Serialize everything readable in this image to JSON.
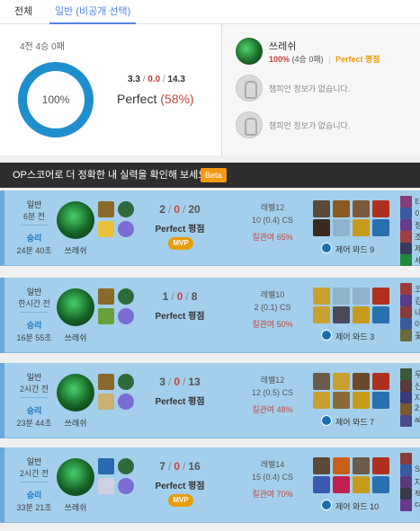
{
  "tabs": [
    "전체",
    "일반 (비공개 선택)"
  ],
  "summary": {
    "record": "4전 4승 0패",
    "win_rate_label": "100%",
    "win_rate_value": 100,
    "kda_kills": "3.3",
    "kda_deaths": "0.0",
    "kda_assists": "14.3",
    "kda_sep": "/",
    "perfect_label": "Perfect",
    "perfect_pct": "(58%)",
    "donut_color": "#1f8ecd"
  },
  "champions": [
    {
      "name": "쓰레쉬",
      "winrate": "100%",
      "record": "(4승 0패)",
      "grade": "Perfect 평점"
    },
    {
      "empty_text": "챔피언 정보가 없습니다."
    },
    {
      "empty_text": "챔피언 정보가 없습니다."
    }
  ],
  "banner": {
    "text": "OP스코어로 더 정확한 내 실력을 확인해 보세요",
    "beta": "Beta"
  },
  "matches": [
    {
      "type": "일반",
      "time_ago": "6분 전",
      "result": "승리",
      "duration": "24분 40초",
      "champion": "쓰레쉬",
      "kills": "2",
      "deaths": "0",
      "assists": "20",
      "grade": "Perfect 평점",
      "mvp": "MVP",
      "level": "레벨12",
      "cs": "10 (0.4) CS",
      "kill_participation": "킬관여 65%",
      "ward": "제어 와드 9",
      "spells": [
        "#8a6a2a",
        "#e8c23a"
      ],
      "runes": [
        "#2f6b3a",
        "#7b6bd4"
      ],
      "items": [
        "#5a4a3a",
        "#8a5a20",
        "#7a5a3a",
        "#b03020",
        "#3a2a20",
        "#8fb3cc",
        "#c89a1c",
        "#2a6fb0"
      ],
      "players": [
        {
          "name": "티",
          "color": "#8a3a7a"
        },
        {
          "name": "이",
          "color": "#3a5aa0"
        },
        {
          "name": "정",
          "color": "#6a3a8a"
        },
        {
          "name": "조",
          "color": "#a04040"
        },
        {
          "name": "제",
          "color": "#3a3a60"
        },
        {
          "name": "세",
          "color": "#1f8a3a"
        }
      ]
    },
    {
      "type": "일반",
      "time_ago": "한시간 전",
      "result": "승리",
      "duration": "16분 55초",
      "champion": "쓰레쉬",
      "kills": "1",
      "deaths": "0",
      "assists": "8",
      "grade": "Perfect 평점",
      "mvp": "",
      "level": "레벨10",
      "cs": "2 (0.1) CS",
      "kill_participation": "킬관여 50%",
      "ward": "제어 와드 3",
      "spells": [
        "#8a6a2a",
        "#6aa03a"
      ],
      "runes": [
        "#2f6b3a",
        "#7b6bd4"
      ],
      "items": [
        "#c8a030",
        "#8fb3cc",
        "#8fb3cc",
        "#b03020",
        "#c8a030",
        "#4a4a5a",
        "#c89a1c",
        "#2a6fb0"
      ],
      "players": [
        {
          "name": "코",
          "color": "#a03a3a"
        },
        {
          "name": "김",
          "color": "#5a3a8a"
        },
        {
          "name": "내",
          "color": "#8a3a3a"
        },
        {
          "name": "야",
          "color": "#3a5a9a"
        },
        {
          "name": "꽃",
          "color": "#6a6a3a"
        }
      ]
    },
    {
      "type": "일반",
      "time_ago": "2시간 전",
      "result": "승리",
      "duration": "23분 44초",
      "champion": "쓰레쉬",
      "kills": "3",
      "deaths": "0",
      "assists": "13",
      "grade": "Perfect 평점",
      "mvp": "",
      "level": "레벨12",
      "cs": "12 (0.5) CS",
      "kill_participation": "킬관여 48%",
      "ward": "제어 와드 7",
      "spells": [
        "#8a6a2a",
        "#c8b070"
      ],
      "runes": [
        "#2f6b3a",
        "#7b6bd4"
      ],
      "items": [
        "#6a5a4a",
        "#c8a030",
        "#6a4a2a",
        "#b03020",
        "#c8a030",
        "#8a6a3a",
        "#c89a1c",
        "#2a6fb0"
      ],
      "players": [
        {
          "name": "우",
          "color": "#3a5a3a"
        },
        {
          "name": "신",
          "color": "#5a3a3a"
        },
        {
          "name": "자",
          "color": "#3a3a7a"
        },
        {
          "name": "2",
          "color": "#7a5a2a"
        },
        {
          "name": "al",
          "color": "#4a4a8a"
        }
      ]
    },
    {
      "type": "일반",
      "time_ago": "2시간 전",
      "result": "승리",
      "duration": "33분 21초",
      "champion": "쓰레쉬",
      "kills": "7",
      "deaths": "0",
      "assists": "16",
      "grade": "Perfect 평점",
      "mvp": "MVP",
      "level": "레벨14",
      "cs": "15 (0.4) CS",
      "kill_participation": "킬관여 70%",
      "ward": "제어 와드 10",
      "spells": [
        "#2a6ab0",
        "#d0d0e0"
      ],
      "runes": [
        "#2f6b3a",
        "#7b6bd4"
      ],
      "items": [
        "#5a4a3a",
        "#c8601a",
        "#6a5a4a",
        "#b03020",
        "#3a5ab0",
        "#c02050",
        "#c89a1c",
        "#2a6fb0"
      ],
      "players": [
        {
          "name": "",
          "color": "#8a3a3a"
        },
        {
          "name": "St",
          "color": "#3a5aa0"
        },
        {
          "name": "자",
          "color": "#5a3a7a"
        },
        {
          "name": "잭",
          "color": "#3a3a4a"
        },
        {
          "name": "ca",
          "color": "#6a3a8a"
        }
      ]
    }
  ]
}
